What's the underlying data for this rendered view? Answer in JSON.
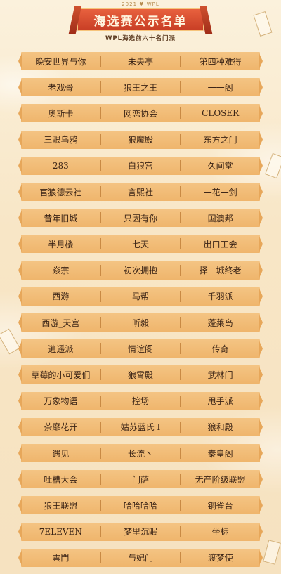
{
  "header": {
    "year_line": "2021 ♥ WPL",
    "title": "海选赛公示名单",
    "subtitle": "WPL海选前六十名门派"
  },
  "rows": [
    [
      "晚安世界与你",
      "未央亭",
      "第四种难得"
    ],
    [
      "老戏骨",
      "狼王之王",
      "一一阁"
    ],
    [
      "奥斯卡",
      "网恋协会",
      "CLOSER"
    ],
    [
      "三眼乌鸦",
      "狼魔殿",
      "东方之门"
    ],
    [
      "283",
      "白狼宫",
      "久间堂"
    ],
    [
      "官狼德云社",
      "言熙社",
      "一花一剑"
    ],
    [
      "昔年旧城",
      "只因有你",
      "国澳邦"
    ],
    [
      "半月楼",
      "七天",
      "出口工会"
    ],
    [
      "焱宗",
      "初次拥抱",
      "择一城终老"
    ],
    [
      "西游",
      "马帮",
      "千羽派"
    ],
    [
      "西游_天宫",
      "昕毅",
      "蓬莱岛"
    ],
    [
      "逍遥派",
      "情谊阁",
      "传奇"
    ],
    [
      "草莓的小可爱们",
      "狼霄殿",
      "武林门"
    ],
    [
      "万象物语",
      "控场",
      "甩手派"
    ],
    [
      "茶靡花开",
      "姑苏蓝氏 Ⅰ",
      "狼和殿"
    ],
    [
      "遇见",
      "长流丶",
      "秦皇阁"
    ],
    [
      "吐槽大会",
      "门萨",
      "无产阶级联盟"
    ],
    [
      "狼王联盟",
      "哈哈哈哈",
      "铜雀台"
    ],
    [
      "7ELEVEN",
      "梦里沉眠",
      "坐标"
    ],
    [
      "雲門",
      "与妃门",
      "渡梦使"
    ]
  ]
}
